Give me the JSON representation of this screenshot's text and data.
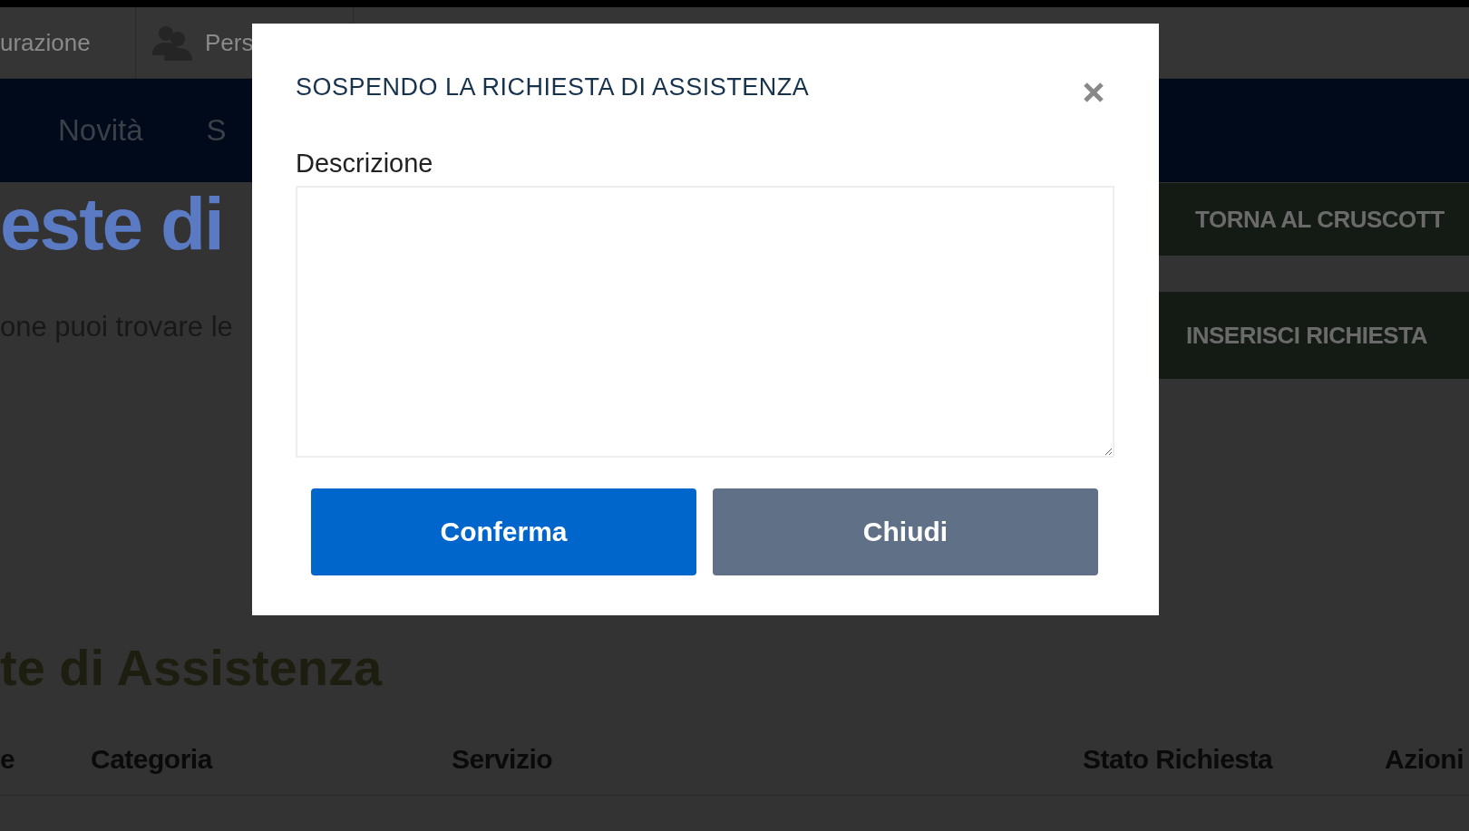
{
  "top_bar": {
    "items": [
      {
        "label": "urazione",
        "kind": "text"
      },
      {
        "label": "Pers",
        "kind": "people"
      }
    ]
  },
  "nav": {
    "items": [
      "Novità",
      "S"
    ]
  },
  "page": {
    "title": "este di",
    "intro": "one puoi trovare le"
  },
  "actions": [
    "TORNA AL CRUSCOTT",
    "INSERISCI RICHIESTA"
  ],
  "section_title": "te di Assistenza",
  "table": {
    "columns": [
      "e",
      "Categoria",
      "Servizio",
      "Stato Richiesta",
      "Azioni"
    ]
  },
  "modal": {
    "title": "SOSPENDO LA RICHIESTA DI ASSISTENZA",
    "field_label": "Descrizione",
    "buttons": [
      {
        "label": "Conferma",
        "kind": "primary"
      },
      {
        "label": "Chiudi",
        "kind": "secondary"
      }
    ]
  }
}
